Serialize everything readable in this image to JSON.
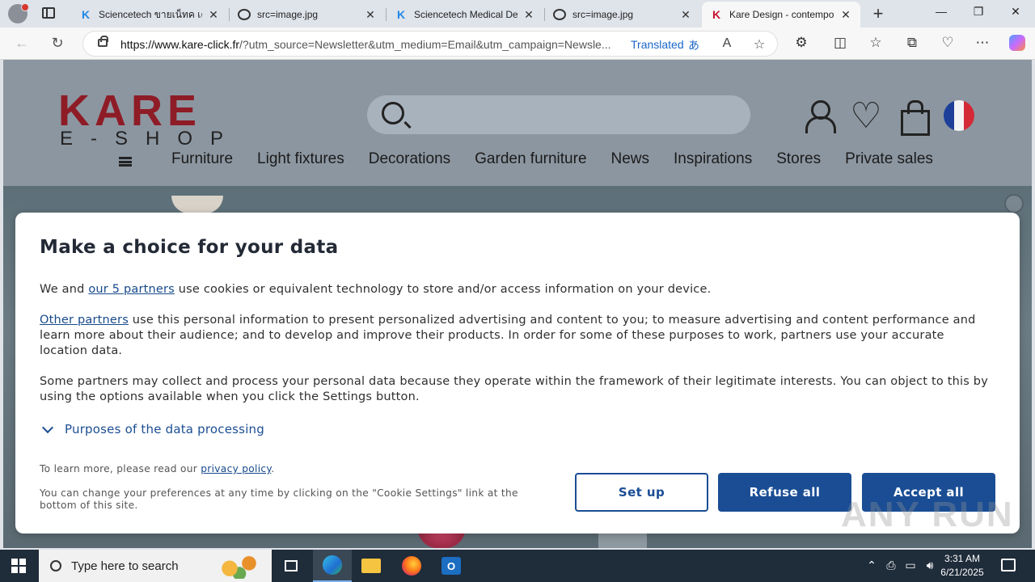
{
  "browser": {
    "tabs": [
      {
        "title": "Sciencetech ขายเน็ทค เครื่อ",
        "favicon": "k-blue",
        "active": false
      },
      {
        "title": "src=image.jpg",
        "favicon": "doc",
        "active": false
      },
      {
        "title": "Sciencetech Medical Devi",
        "favicon": "k-blue",
        "active": false
      },
      {
        "title": "src=image.jpg",
        "favicon": "doc",
        "active": false
      },
      {
        "title": "Kare Design - contempor",
        "favicon": "k-red",
        "active": true
      }
    ],
    "url_domain": "https://www.kare-click.fr",
    "url_rest": "/?utm_source=Newsletter&utm_medium=Email&utm_campaign=Newsle...",
    "translated_label": "Translated",
    "translate_icon_glyph": "あ"
  },
  "site": {
    "logo_top": "KARE",
    "logo_bottom": "E-SHOP",
    "search_placeholder": "",
    "nav": [
      "Furniture",
      "Light fixtures",
      "Decorations",
      "Garden furniture",
      "News",
      "Inspirations",
      "Stores",
      "Private sales"
    ],
    "colors": {
      "brand": "#8e1c26",
      "header_bg": "#8c96a0"
    }
  },
  "cookie": {
    "title": "Make a choice for your data",
    "p1_prefix": "We and ",
    "p1_link": "our 5 partners",
    "p1_suffix": " use cookies or equivalent technology to store and/or access information on your device.",
    "p2_link": "Other partners",
    "p2_suffix": " use this personal information to present personalized advertising and content to you; to measure advertising and content performance and learn more about their audience; and to develop and improve their products. In order for some of these purposes to work, partners use your accurate location data.",
    "p3": "Some partners may collect and process your personal data because they operate within the framework of their legitimate interests. You can object to this by using the options available when you click the Settings button.",
    "purposes_label": "Purposes of the data processing",
    "learn_prefix": "To learn more, please read our ",
    "learn_link": "privacy policy",
    "learn_suffix": ".",
    "change_note": "You can change your preferences at any time by clicking on the \"Cookie Settings\" link at the bottom of this site.",
    "btn_setup": "Set up",
    "btn_refuse": "Refuse all",
    "btn_accept": "Accept all",
    "accent_color": "#1a4d94"
  },
  "watermark": "ANY RUN",
  "taskbar": {
    "search_placeholder": "Type here to search",
    "time": "3:31 AM",
    "date": "6/21/2025",
    "outlook_letter": "O"
  }
}
